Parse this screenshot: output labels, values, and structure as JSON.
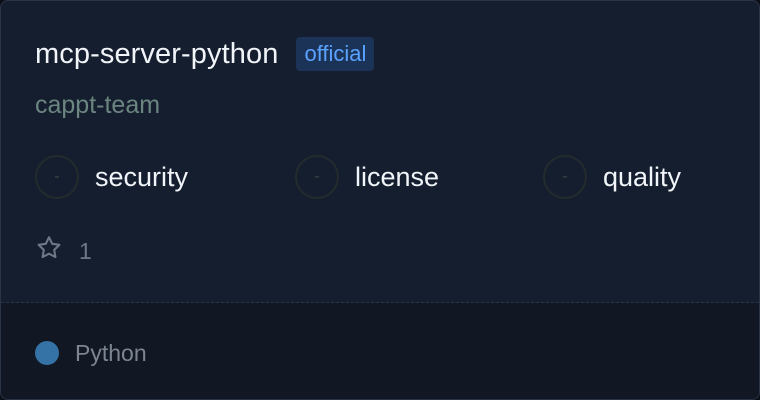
{
  "repo": {
    "name": "mcp-server-python",
    "badge": "official",
    "owner": "cappt-team"
  },
  "metrics": [
    {
      "label": "security",
      "value": "-"
    },
    {
      "label": "license",
      "value": "-"
    },
    {
      "label": "quality",
      "value": "-"
    }
  ],
  "stars": {
    "icon": "star-outline-icon",
    "count": "1"
  },
  "language": {
    "name": "Python",
    "color": "#3572a5"
  },
  "colors": {
    "badge_bg": "#1c3358",
    "badge_text": "#5aa2ff",
    "owner_text": "#6b8580"
  }
}
